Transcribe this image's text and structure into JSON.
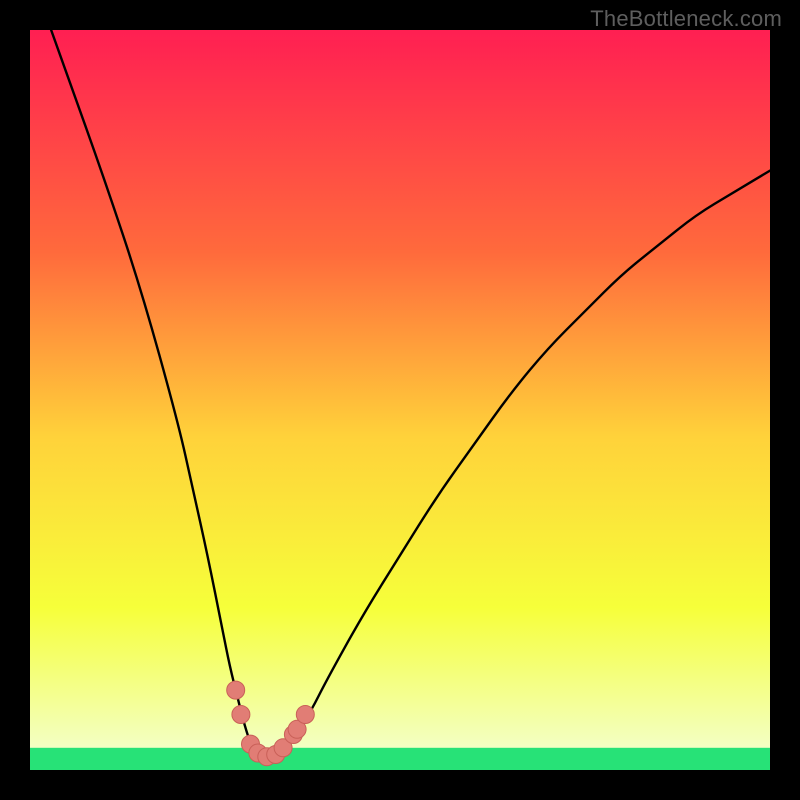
{
  "watermark": "TheBottleneck.com",
  "colors": {
    "frame": "#000000",
    "curve": "#000000",
    "marker_fill": "#e17d75",
    "marker_stroke": "#c96058",
    "green_band": "#27e277",
    "gradient_top": "#ff1f52",
    "gradient_upper": "#ff6a3c",
    "gradient_mid": "#ffd23a",
    "gradient_lower": "#f6ff3a",
    "gradient_bottom": "#f2ffd9"
  },
  "chart_data": {
    "type": "line",
    "title": "",
    "xlabel": "",
    "ylabel": "",
    "xlim": [
      0,
      100
    ],
    "ylim": [
      0,
      100
    ],
    "grid": false,
    "legend": false,
    "series": [
      {
        "name": "bottleneck-curve",
        "x": [
          0,
          5,
          10,
          15,
          20,
          22,
          24,
          26,
          27,
          28,
          29,
          30,
          31,
          32,
          33,
          34,
          36,
          38,
          40,
          45,
          50,
          55,
          60,
          65,
          70,
          75,
          80,
          85,
          90,
          95,
          100
        ],
        "y": [
          108,
          94,
          80,
          65,
          47,
          38,
          29,
          19,
          14,
          10,
          6,
          3,
          2,
          1.8,
          2,
          3,
          5,
          8,
          12,
          21,
          29,
          37,
          44,
          51,
          57,
          62,
          67,
          71,
          75,
          78,
          81
        ]
      }
    ],
    "markers": {
      "name": "highlight-points",
      "x": [
        27.8,
        28.5,
        29.8,
        30.8,
        32.0,
        33.2,
        34.2,
        35.6,
        36.1,
        37.2
      ],
      "y": [
        10.8,
        7.5,
        3.5,
        2.3,
        1.8,
        2.1,
        3.0,
        4.8,
        5.5,
        7.5
      ]
    },
    "green_band_y": [
      0,
      3
    ]
  }
}
